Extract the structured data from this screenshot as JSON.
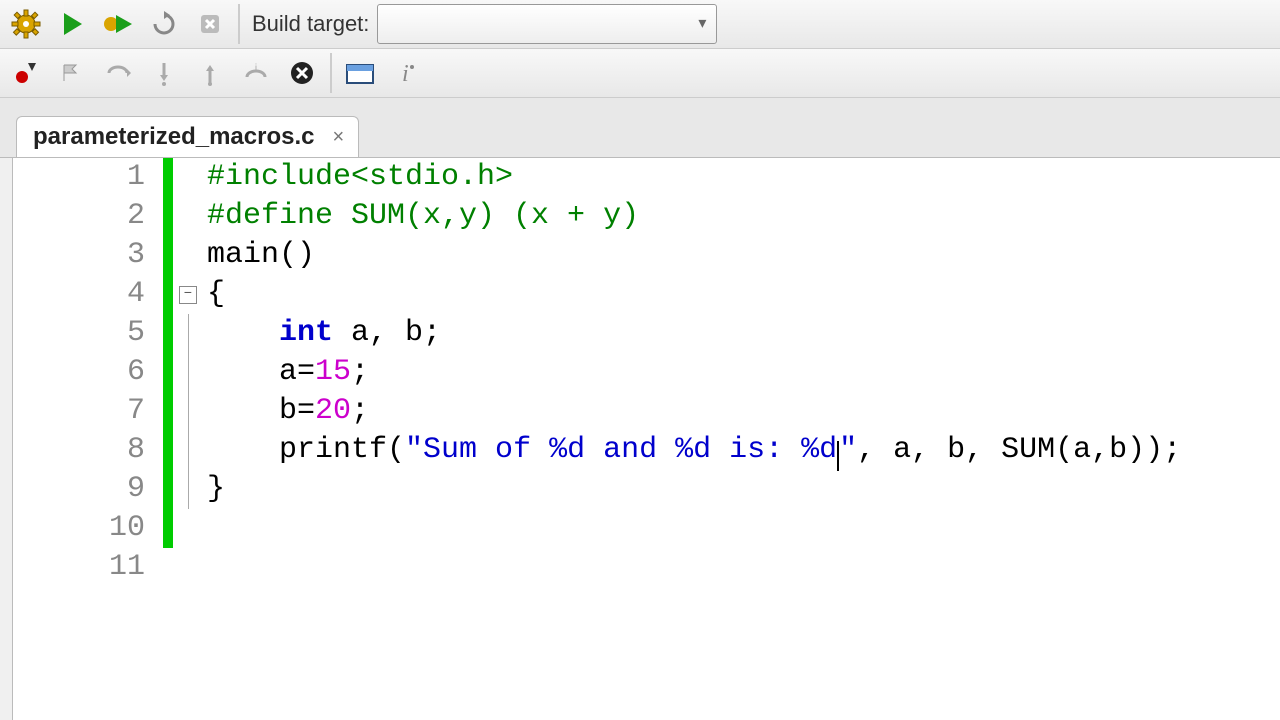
{
  "toolbar1": {
    "build_label": "Build target:",
    "build_value": ""
  },
  "tab": {
    "title": "parameterized_macros.c",
    "close": "×"
  },
  "editor": {
    "lines": [
      {
        "n": "1",
        "tokens": [
          {
            "cls": "tok-green",
            "t": "#include<stdio.h>"
          }
        ]
      },
      {
        "n": "2",
        "tokens": [
          {
            "cls": "tok-green",
            "t": "#define SUM(x,y) (x + y)"
          }
        ]
      },
      {
        "n": "3",
        "tokens": [
          {
            "cls": "tok-black",
            "t": "main"
          },
          {
            "cls": "tok-black",
            "t": "()"
          }
        ]
      },
      {
        "n": "4",
        "fold": true,
        "tokens": [
          {
            "cls": "tok-black",
            "t": "{"
          }
        ]
      },
      {
        "n": "5",
        "foldline": true,
        "tokens": [
          {
            "cls": "tok-black",
            "t": "    "
          },
          {
            "cls": "tok-blue",
            "t": "int"
          },
          {
            "cls": "tok-black",
            "t": " a, b;"
          }
        ]
      },
      {
        "n": "6",
        "foldline": true,
        "tokens": [
          {
            "cls": "tok-black",
            "t": "    a="
          },
          {
            "cls": "tok-num",
            "t": "15"
          },
          {
            "cls": "tok-black",
            "t": ";"
          }
        ]
      },
      {
        "n": "7",
        "foldline": true,
        "tokens": [
          {
            "cls": "tok-black",
            "t": "    b="
          },
          {
            "cls": "tok-num",
            "t": "20"
          },
          {
            "cls": "tok-black",
            "t": ";"
          }
        ]
      },
      {
        "n": "8",
        "foldline": true,
        "tokens": [
          {
            "cls": "tok-black",
            "t": "    printf("
          },
          {
            "cls": "tok-str",
            "t": "\"Sum of %d and %d is: %d"
          },
          {
            "cls": "cursor",
            "t": ""
          },
          {
            "cls": "tok-str",
            "t": "\""
          },
          {
            "cls": "tok-black",
            "t": ", a, b, SUM(a,b));"
          }
        ]
      },
      {
        "n": "9",
        "foldline": true,
        "tokens": [
          {
            "cls": "tok-black",
            "t": "}"
          }
        ]
      },
      {
        "n": "10",
        "tokens": []
      },
      {
        "n": "11",
        "end": true,
        "tokens": []
      }
    ]
  }
}
